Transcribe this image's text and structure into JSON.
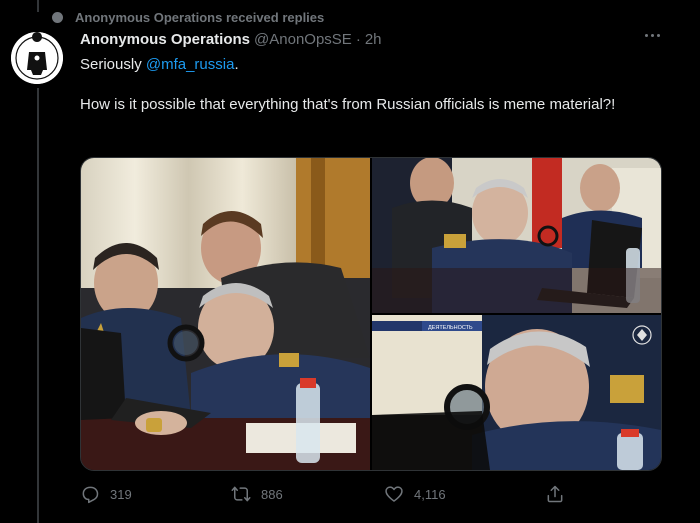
{
  "social_context": {
    "text": "Anonymous Operations received replies",
    "icon": "dot-icon"
  },
  "tweet": {
    "display_name": "Anonymous Operations",
    "handle": "@AnonOpsSE",
    "separator": "·",
    "time": "2h",
    "text_line1_prefix": "Seriously ",
    "mention": "@mfa_russia",
    "text_line1_suffix": ".",
    "text_line2": "How is it possible that everything that's from Russian officials is meme material?!",
    "media": [
      {
        "description_icon": "photo-officials-laptop-magnifier"
      },
      {
        "description_icon": "photo-officials-closeup"
      },
      {
        "description_icon": "photo-broadcast-still",
        "caption": "ДЕЯТЕЛЬНОСТЬ"
      }
    ]
  },
  "actions": {
    "replies": "319",
    "retweets": "886",
    "likes": "4,116"
  },
  "colors": {
    "background": "#000000",
    "text_primary": "#e7e9ea",
    "text_secondary": "#71767b",
    "accent": "#1d9bf0"
  }
}
